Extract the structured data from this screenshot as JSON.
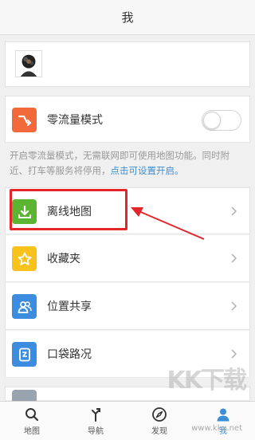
{
  "header": {
    "title": "我"
  },
  "zero_traffic": {
    "label": "零流量模式",
    "enabled": false
  },
  "description": {
    "text": "开启零流量模式，无需联网即可使用地图功能。同时附近、打车等服务将停用，",
    "link": "点击可设置开启。"
  },
  "menu": {
    "offline_map": "离线地图",
    "favorites": "收藏夹",
    "location_share": "位置共享",
    "traffic": "口袋路况"
  },
  "tabs": [
    {
      "label": "地图",
      "icon": "search-icon"
    },
    {
      "label": "导航",
      "icon": "navigation-icon"
    },
    {
      "label": "发现",
      "icon": "compass-icon"
    },
    {
      "label": "我",
      "icon": "user-icon",
      "active": true
    }
  ],
  "watermark": {
    "logo": "KK下载",
    "url": "www.kkx.net"
  },
  "colors": {
    "accent": "#3b8fd6",
    "zero_traffic_icon": "#f26a3c",
    "offline_map_icon": "#5cb531",
    "favorites_icon": "#f7c21b",
    "location_share_icon": "#3c8de0",
    "traffic_icon": "#3c8de0",
    "annotation": "#e4262c"
  }
}
